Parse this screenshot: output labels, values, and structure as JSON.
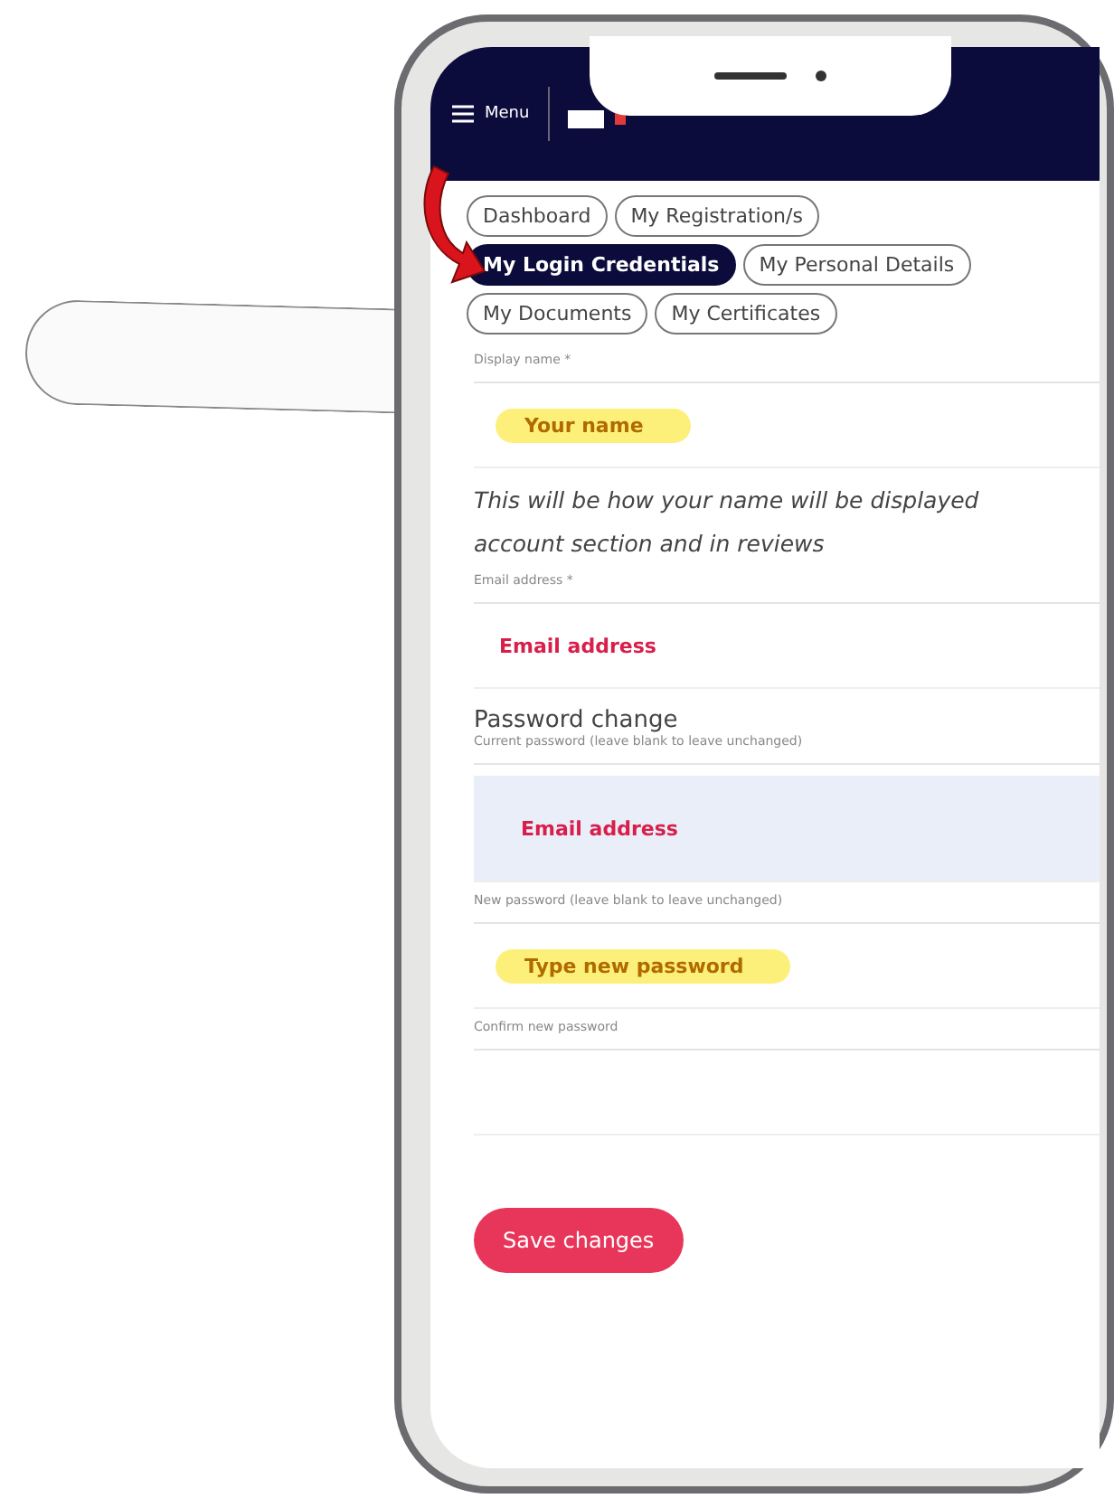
{
  "header": {
    "menu_label": "Menu"
  },
  "tabs": [
    [
      {
        "label": "Dashboard",
        "selected": false
      },
      {
        "label": "My Registration/s",
        "selected": false
      }
    ],
    [
      {
        "label": "My Login Credentials",
        "selected": true
      },
      {
        "label": "My Personal Details",
        "selected": false
      }
    ],
    [
      {
        "label": "My Documents",
        "selected": false
      },
      {
        "label": "My Certificates",
        "selected": false
      }
    ]
  ],
  "form": {
    "sections": [
      {
        "kind": "field",
        "label": "Display name *",
        "placeholder": "Your name",
        "highlighted": true,
        "focused": false
      },
      {
        "kind": "note",
        "lines": [
          "This will be how your name will be displayed",
          "account section and in reviews"
        ]
      },
      {
        "kind": "field",
        "label": "Email address *",
        "placeholder": "Email address",
        "highlighted": false,
        "focused": false
      },
      {
        "kind": "heading",
        "text": "Password change"
      },
      {
        "kind": "field",
        "label": "Current password (leave blank to leave unchanged)",
        "placeholder": "Email address",
        "highlighted": false,
        "focused": true
      },
      {
        "kind": "field",
        "label": "New password (leave blank to leave unchanged)",
        "placeholder": "Type new password",
        "highlighted": true,
        "focused": false
      },
      {
        "kind": "field",
        "label": "Confirm new password",
        "focused": false
      }
    ]
  },
  "save_button": "Save changes"
}
